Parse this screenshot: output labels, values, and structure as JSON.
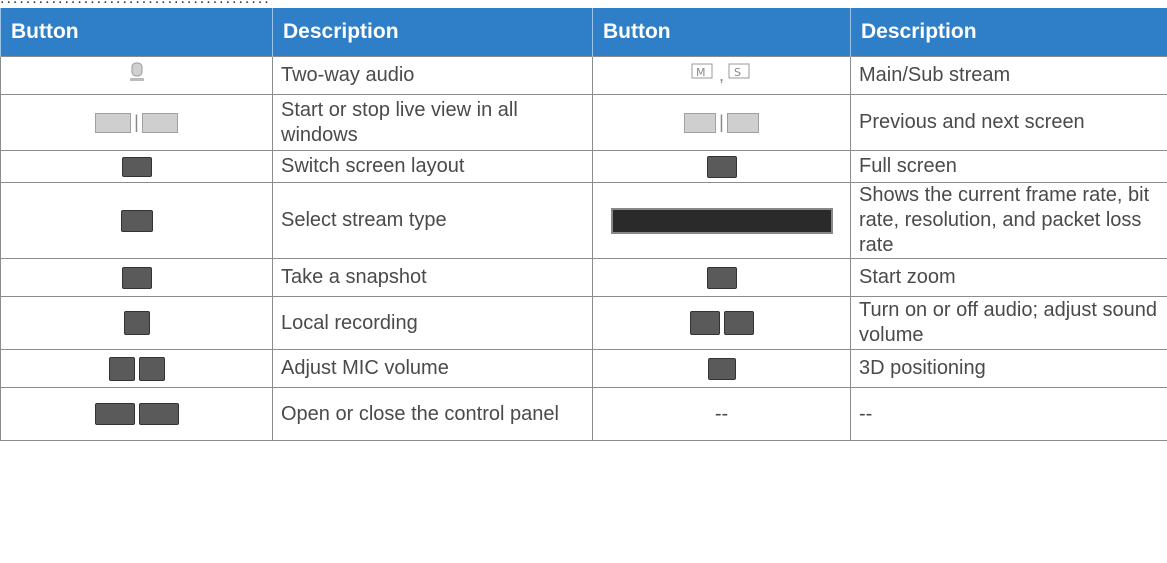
{
  "header": {
    "col1": "Button",
    "col2": "Description",
    "col3": "Button",
    "col4": "Description"
  },
  "rows": [
    {
      "left_icon": "microphone-icon",
      "left_desc": "Two-way audio",
      "right_icon": "main-sub-stream-icon",
      "right_desc": "Main/Sub stream"
    },
    {
      "left_icon": "play-stop-icon",
      "left_desc": "Start or stop live view in all windows",
      "right_icon": "previous-next-icon",
      "right_desc": "Previous and next screen"
    },
    {
      "left_icon": "layout-icon",
      "left_desc": "Switch screen layout",
      "right_icon": "fullscreen-icon",
      "right_desc": "Full screen"
    },
    {
      "left_icon": "stream-type-icon",
      "left_desc": "Select stream type",
      "right_icon": "stats-bar-icon",
      "right_desc": "Shows the current frame rate, bit rate, resolution, and packet loss rate"
    },
    {
      "left_icon": "camera-icon",
      "left_desc": "Take a snapshot",
      "right_icon": "zoom-icon",
      "right_desc": "Start zoom"
    },
    {
      "left_icon": "record-icon",
      "left_desc": "Local recording",
      "right_icon": "audio-toggle-icon",
      "right_desc": "Turn on or off audio; adjust sound volume"
    },
    {
      "left_icon": "mic-volume-icon",
      "left_desc": "Adjust MIC volume",
      "right_icon": "positioning-3d-icon",
      "right_desc": "3D positioning"
    },
    {
      "left_icon": "panel-toggle-icon",
      "left_desc": "Open or close the control panel",
      "right_text": "--",
      "right_desc": "--"
    }
  ]
}
